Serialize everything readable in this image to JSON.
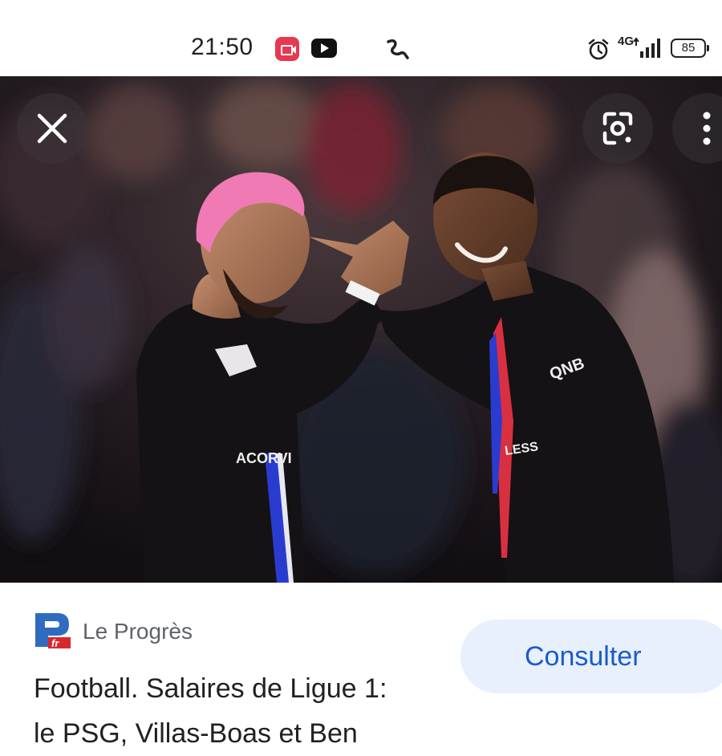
{
  "status_bar": {
    "time": "21:50",
    "network": "4G",
    "battery": "85",
    "icons": [
      "screen-record-icon",
      "youtube-icon",
      "squiggle-icon",
      "alarm-icon",
      "signal-icon",
      "battery-icon"
    ]
  },
  "viewer": {
    "icons": [
      "close-icon",
      "lens-icon",
      "more-vert-icon"
    ],
    "jersey_texts": [
      "ACORVI",
      "QNB",
      "LESS"
    ]
  },
  "card": {
    "source_logo_text": "P",
    "source": "Le Progrès",
    "button_label": "Consulter",
    "headline_line1": "Football. Salaires de Ligue 1:",
    "headline_line2": "le PSG, Villas-Boas et Ben"
  },
  "colors": {
    "button_bg": "#e8f0fe",
    "button_text": "#1a5cc8",
    "rec_badge": "#e8384f",
    "hair_pink": "#f07ab4"
  }
}
